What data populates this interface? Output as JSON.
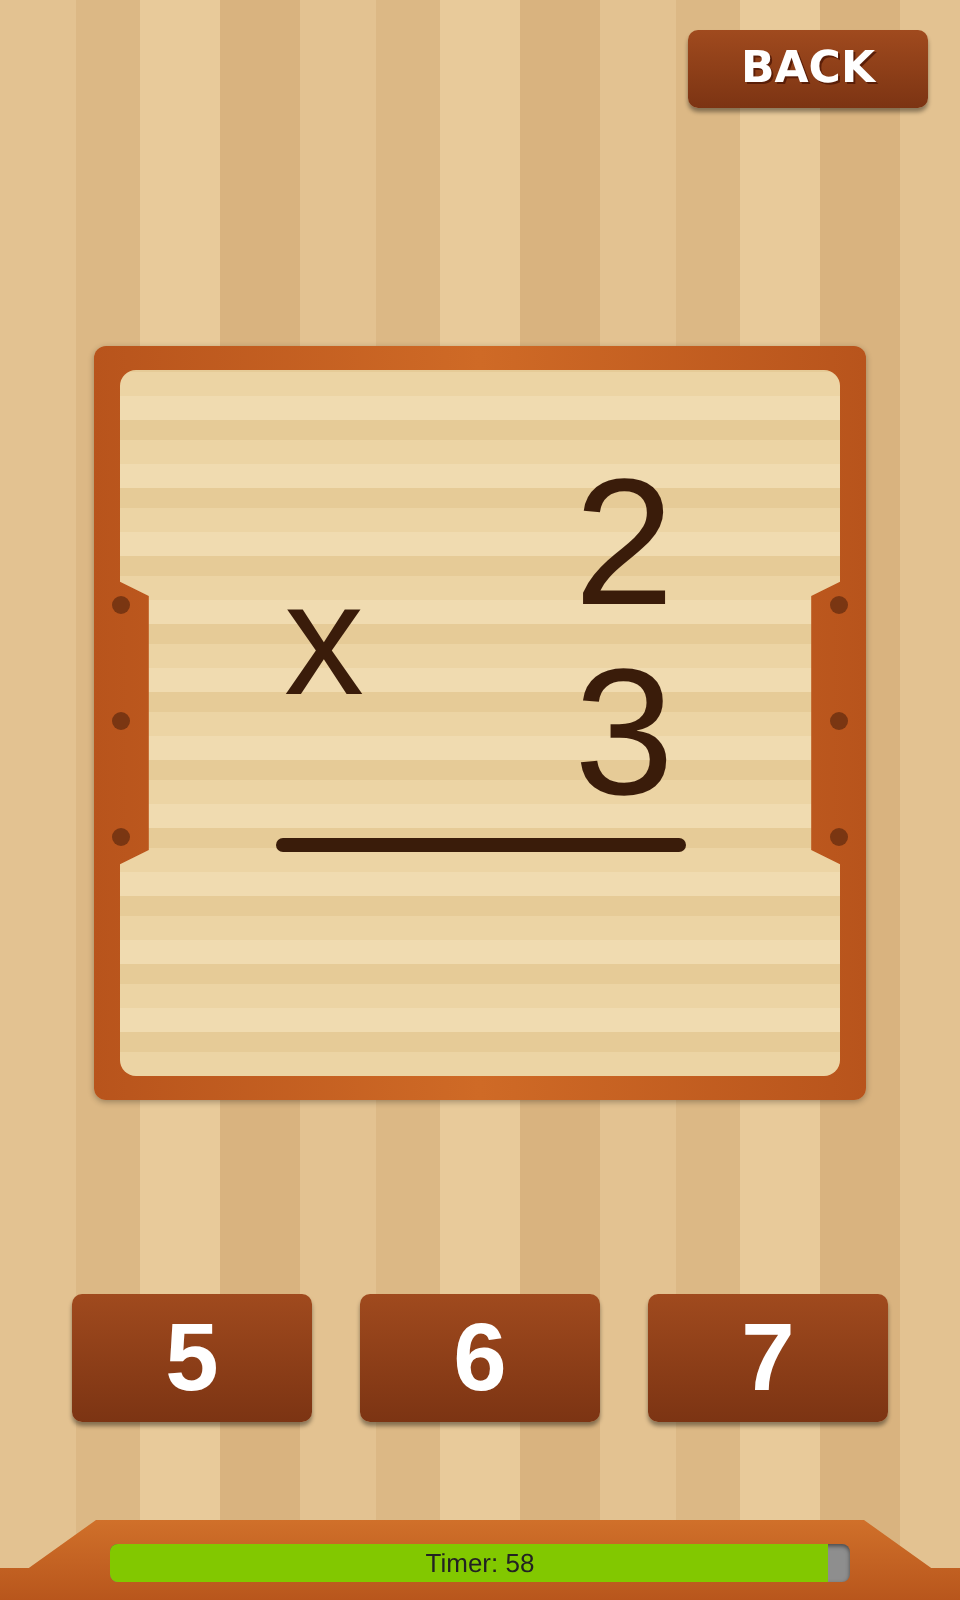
{
  "back_button": "BACK",
  "problem": {
    "operator": "x",
    "operands": [
      "2",
      "3"
    ]
  },
  "answers": [
    "5",
    "6",
    "7"
  ],
  "timer": {
    "label": "Timer: 58",
    "level": 0.97
  }
}
